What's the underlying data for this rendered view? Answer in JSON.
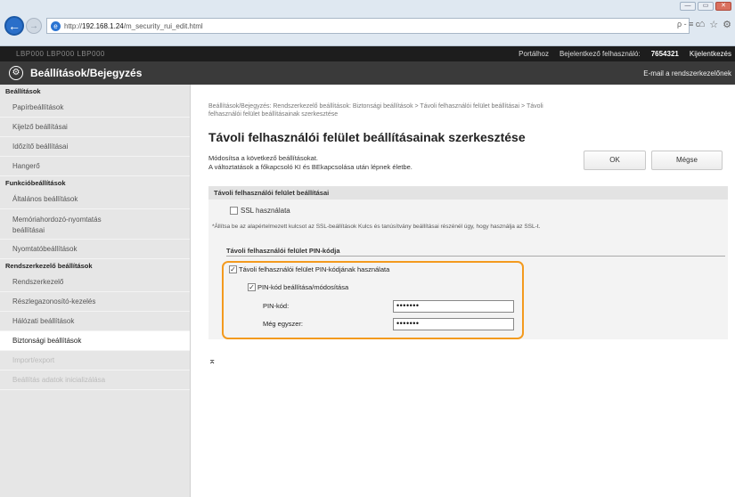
{
  "browser": {
    "url_prefix": "http://",
    "url_host": "192.168.1.24",
    "url_path": "/m_security_rui_edit.html",
    "addr_tools": "ρ - ≡ c",
    "win_min": "—",
    "win_max": "▭",
    "win_close": "✕"
  },
  "topbar": {
    "device_name": "LBP000   LBP000 LBP000",
    "portal": "Portálhoz",
    "logged_in_label": "Bejelentkező felhasználó:",
    "user_id": "7654321",
    "logout": "Kijelentkezés"
  },
  "header": {
    "title": "Beállítások/Bejegyzés",
    "email_link": "E-mail a rendszerkezelőnek"
  },
  "sidebar": {
    "section1": "Beállítások",
    "item_paper": "Papírbeállítások",
    "item_display": "Kijelző beállításai",
    "item_timer": "Időzítő beállításai",
    "item_sound": "Hangerő",
    "section2": "Funkcióbeállítások",
    "item_general": "Általános beállítások",
    "item_media_line1": "Memóriahordozó-nyomtatás",
    "item_media_line2": "beállításai",
    "item_printer": "Nyomtatóbeállítások",
    "section3": "Rendszerkezelő beállítások",
    "item_sysadmin": "Rendszerkezelő",
    "item_dept": "Részlegazonosító-kezelés",
    "item_network": "Hálózati beállítások",
    "item_security": "Biztonsági beállítások",
    "item_import": "Import/export",
    "item_extra": "Beállítás adatok inicializálása"
  },
  "main": {
    "breadcrumb_line1": "Beállítások/Bejegyzés: Rendszerkezelő beállítások: Biztonsági beállítások > Távoli felhasználói felület beállításai > Távoli",
    "breadcrumb_line2": "felhasználói felület beállításainak szerkesztése",
    "title": "Távoli felhasználói felület beállításainak szerkesztése",
    "desc_line1": "Módosítsa a következő beállításokat.",
    "desc_line2": "A változtatások a főkapcsoló KI és BEkapcsolása után lépnek életbe.",
    "ok_label": "OK",
    "cancel_label": "Mégse",
    "panel_title": "Távoli felhasználói felület beállításai",
    "ssl_label": "SSL használata",
    "ssl_note": "*Állítsa be az alapértelmezett kulcsot az SSL-beállítások Kulcs és tanúsítvány beállításai részénél úgy, hogy használja az SSL-t.",
    "pin_section_title": "Távoli felhasználói felület PIN-kódja",
    "pin_use_label": "Távoli felhasználói felület PIN-kódjának használata",
    "pin_set_label": "PIN-kód beállítása/módosítása",
    "pin_label": "PIN-kód:",
    "pin_value": "•••••••",
    "confirm_label": "Még egyszer:",
    "confirm_value": "•••••••",
    "to_top": "⌅"
  },
  "states": {
    "ssl_checked": false,
    "pin_use_checked": true,
    "pin_set_checked": true
  },
  "colors": {
    "highlight": "#f39a1e",
    "header_bg": "#3a3a3a",
    "topbar_bg": "#1d1d1d"
  }
}
